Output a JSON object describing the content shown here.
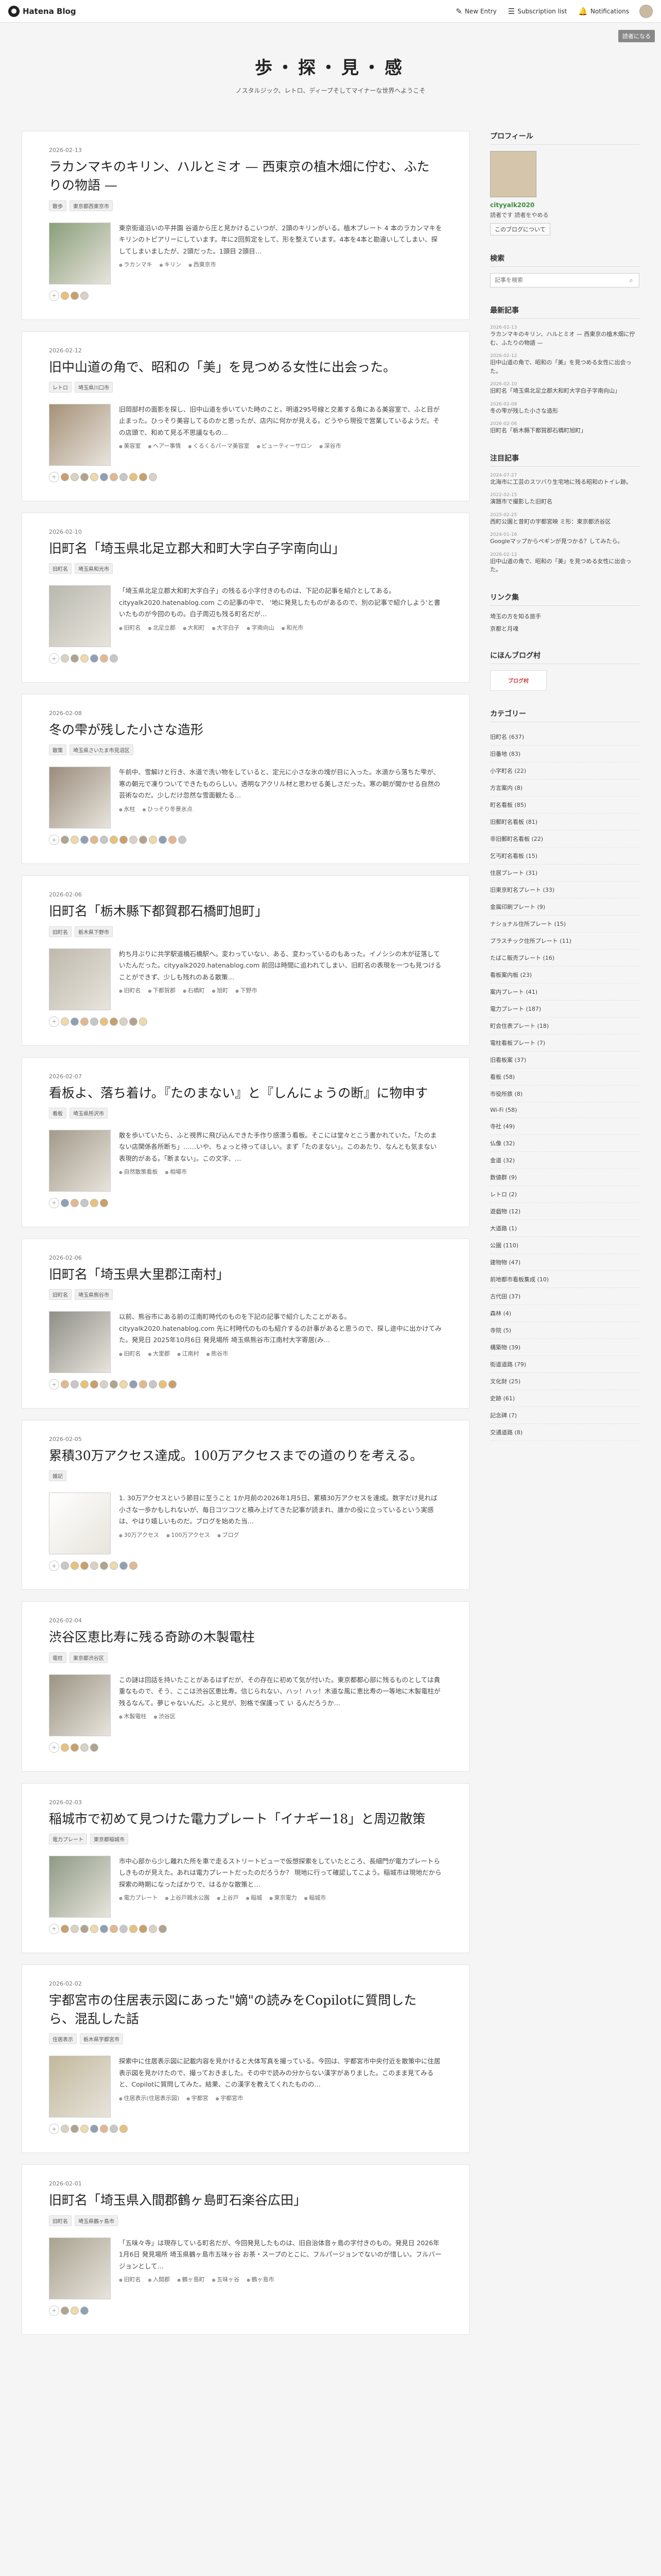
{
  "topbar": {
    "brand": "Hatena Blog",
    "new_entry": "New Entry",
    "subscription": "Subscription list",
    "notifications": "Notifications"
  },
  "readers_label": "読者になる",
  "blog": {
    "title": "歩・探・見・感",
    "description": "ノスタルジック、レトロ、ディープそしてマイナーな世界へようこそ"
  },
  "entries": [
    {
      "date": "2026-02-13",
      "title": "ラカンマキのキリン、ハルとミオ — 西東京の植木畑に佇む、ふたりの物語 —",
      "cats": [
        "散歩",
        "東京都西東京市"
      ],
      "excerpt": "東京街道沿いの平井園 谷道から圧と見かけるこいつが、2頭のキリンがいる。植木プレート 4 本のラカンマキをキリンのトピアリーにしています。年に2回剪定をして、形を整えています。4本を4本と勘違いしてしまい、探してしまいましたが、2頭だった。1頭目 2頭目…",
      "keywords": [
        "ラカンマキ",
        "キリン",
        "西東京市"
      ]
    },
    {
      "date": "2026-02-12",
      "title": "旧中山道の角で、昭和の「美」を見つめる女性に出会った。",
      "cats": [
        "レトロ",
        "埼玉県川口市"
      ],
      "excerpt": "旧岡部村の面影を探し、旧中山道を歩いていた時のこと。明道295号線と交差する角にある美容室で、ふと目が止まった。ひっそり美容してるのかと思ったが、店内に何かが見える。どうやら現役で営業しているようだ。その店頭で、和めて見る不思議なもの…",
      "keywords": [
        "美容室",
        "ヘアー事情",
        "くるくるパーマ美容室",
        "ビューティーサロン",
        "深谷市"
      ]
    },
    {
      "date": "2026-02-10",
      "title": "旧町名「埼玉県北足立郡大和町大字白子字南向山」",
      "cats": [
        "旧町名",
        "埼玉県和光市"
      ],
      "excerpt": "「埼玉県北足立郡大和町大字白子」の残るる小字付きのものは、下記の記事を紹介としてある。cityyalk2020.hatenablog.com この記事の中で、 '地に発見したものがあるので、別の記事で紹介しよう'と書いたものが今回のもの。白子周辺も残る町名だが…",
      "keywords": [
        "旧町名",
        "北足立郡",
        "大和町",
        "大字白子",
        "字南向山",
        "和光市"
      ]
    },
    {
      "date": "2026-02-08",
      "title": "冬の雫が残した小さな造形",
      "cats": [
        "散策",
        "埼玉県さいたま市見沼区"
      ],
      "excerpt": "午前中、雪解けと行き、水道で洗い物をしていると、定元に小さな氷の塊が目に入った。水滴から落ちた雫が、寒の朝元で凍りついてできたものらしい。透明なアクリル材と思わせる美しさだった。寒の朝が聞かせる自然の芸術なのだ。少しだけ忽然な雪面観たる…",
      "keywords": [
        "氷柱",
        "ひっそり冬景氷点"
      ]
    },
    {
      "date": "2026-02-06",
      "title": "旧町名「栃木縣下都賀郡石橋町旭町」",
      "cats": [
        "旧町名",
        "栃木県下野市"
      ],
      "excerpt": "約ち月ぶりに共学駅道橋石橋駅へ。変わっていない、ある、変わっているのもあった。イノシシの木が征落していたんだった。cityyalk2020.hatenablog.com 前回は時間に追われてしまい、旧町名の表現を一つも見つけることができず、少しも残れのある散策…",
      "keywords": [
        "旧町名",
        "下都賀郡",
        "石橋町",
        "旭町",
        "下野市"
      ]
    },
    {
      "date": "2026-02-07",
      "title": "看板よ、落ち着け。『たのまない』と『しんにょうの断』に物申す",
      "cats": [
        "看板",
        "埼玉県所沢市"
      ],
      "excerpt": "散を歩いていたら、ふと視界に飛び込んできた手作り感漂う看板。そこには堂々とこう書かれていた。「たのまない店関係各所断ち」……いや、ちょっと待ってほしい。まず「たのまない」。このあたり、なんとも気まない表現的がある。「断まない」。この文字、…",
      "keywords": [
        "自然散策看板",
        "相場市"
      ]
    },
    {
      "date": "2026-02-06",
      "title": "旧町名「埼玉県大里郡江南村」",
      "cats": [
        "旧町名",
        "埼玉県熊谷市"
      ],
      "excerpt": "以前、熊谷市にある前の江南町時代のものを下記の記事で紹介したことがある。cityyalk2020.hatenablog.com 先に村時代のものも紹介するの計事があると思うので、探し途中に出かけてみた。発見日 2025年10月6日 発見場所 埼玉県熊谷市江南村大字寄居(み…",
      "keywords": [
        "旧町名",
        "大里郡",
        "江南村",
        "熊谷市"
      ]
    },
    {
      "date": "2026-02-05",
      "title": "累積30万アクセス達成。100万アクセスまでの道のりを考える。",
      "cats": [
        "雑記"
      ],
      "excerpt": "1. 30万アクセスという節目に至うこと 1か月前の2026年1月5日、累積30万アクセスを達成。数字だけ見れば小さな一歩かもしれないが、毎日コツコツと積み上げてきた記事が読まれ、誰かの役に立っているという実感は、やはり嬉しいものだ。ブログを始めた当…",
      "keywords": [
        "30万アクセス",
        "100万アクセス",
        "ブログ"
      ]
    },
    {
      "date": "2026-02-04",
      "title": "渋谷区恵比寿に残る奇跡の木製電柱",
      "cats": [
        "電柱",
        "東京都渋谷区"
      ],
      "excerpt": "この謎は回話を持いたことがあるはずだが、その存在に初めて気が付いた。東京都都心部に残るものとしては貴重なもので、そう、ここは渋谷区恵比寿。信じられない、ハッ！ハッ！木道な風に恵比寿の一等地に木製電柱が残るなんて。夢じゃないんだ。ふと見が、別格で保護って い るんだろうか…",
      "keywords": [
        "木製電柱",
        "渋谷区"
      ]
    },
    {
      "date": "2026-02-03",
      "title": "稲城市で初めて見つけた電力プレート「イナギー18」と周辺散策",
      "cats": [
        "電力プレート",
        "東京都稲城市"
      ],
      "excerpt": "市中心部から少し離れた所を車で走るストリートビューで仮想探索をしていたところ、長細門が電力プレートらしきものが見えた。あれは電力プレートだったのだろうか？ 現地に行って確認してこよう。稲城市は現地だから探索の時期になったばかりで、はるかな散策と…",
      "keywords": [
        "電力プレート",
        "上谷戸親水公園",
        "上谷戸",
        "稲城",
        "東京電力",
        "稲城市"
      ]
    },
    {
      "date": "2026-02-02",
      "title": "宇都宮市の住居表示図にあった\"嫡\"の読みをCopilotに質問したら、混乱した話",
      "cats": [
        "住居表示",
        "栃木県宇都宮市"
      ],
      "excerpt": "探索中に住居表示図に記載内容を見かけると大体写真を撮っている。今回は、宇都宮市中央付近を散策中に住居表示図を見かけたので、撮っておきました。その中で読みの分からない漢字がありました。このまま見てみると、Copilotに質問してみた。結果、この漢字を教えてくれたものの…",
      "keywords": [
        "住居表示(住居表示図)",
        "宇都宮",
        "宇都宮市"
      ]
    },
    {
      "date": "2026-02-01",
      "title": "旧町名「埼玉県入間郡鶴ヶ島町石楽谷広田」",
      "cats": [
        "旧町名",
        "埼玉県鶴ヶ島市"
      ],
      "excerpt": "「五味々寺」は現存している町名だが、今回発見したものは、旧自治体音ヶ島の字付きのもの。発見日 2026年1月6日 発見場所 埼玉県鶴ヶ島市五味ヶ谷 お茶・スープのとこに、フルパージョンでないのが惜しい。フルバージョンとして…",
      "keywords": [
        "旧町名",
        "入間郡",
        "鶴ヶ島町",
        "五味ヶ谷",
        "鶴ヶ島市"
      ]
    }
  ],
  "sidebar": {
    "profile_title": "プロフィール",
    "profile_id": "cityyalk2020",
    "readers_count": "読者です 読者をやめる",
    "follow": "このブログについて",
    "search_title": "検索",
    "search_placeholder": "記事を検索",
    "recent_title": "最新記事",
    "recent": [
      {
        "date": "2026-02-13",
        "title": "ラカンマキのキリン、ハルとミオ — 西東京の植木畑に佇む、ふたりの物語 —"
      },
      {
        "date": "2026-02-12",
        "title": "旧中山道の角で、昭和の「美」を見つめる女性に出会った。"
      },
      {
        "date": "2026-02-10",
        "title": "旧町名「埼玉県北足立郡大和町大字白子字南向山」"
      },
      {
        "date": "2026-02-08",
        "title": "冬の雫が残した小さな造形"
      },
      {
        "date": "2026-02-06",
        "title": "旧町名「栃木縣下都賀郡石橋町旭町」"
      }
    ],
    "popular_title": "注目記事",
    "popular": [
      {
        "date": "2024-07-27",
        "title": "北海市に工芸のスツバり生宅地に残る昭和のトイレ跡。"
      },
      {
        "date": "2022-02-15",
        "title": "演題市で撮影した旧町名"
      },
      {
        "date": "2025-02-25",
        "title": "西町公園と昔町の宇都宮映 ミ形：東京都渋谷区"
      },
      {
        "date": "2024-01-16",
        "title": "Googleマップからペギンが見つかる？してみたら。"
      },
      {
        "date": "2026-02-12",
        "title": "旧中山道の角で、昭和の「美」を見つめる女性に出会った。"
      }
    ],
    "links_title": "リンク集",
    "links": [
      "埼玉の方を知る旅手",
      "京都と月魂"
    ],
    "ranking_title": "にほんブログ村",
    "ranking_label": "ブログ村",
    "categories_title": "カテゴリー",
    "categories": [
      "旧町名 (637)",
      "旧番地 (83)",
      "小字町名 (22)",
      "方言案内 (8)",
      "町名看板 (85)",
      "旧郵町名看板 (81)",
      "非旧郵町名看板 (22)",
      "乞丐町名看板 (15)",
      "住居プレート (31)",
      "旧東京町名プレート (33)",
      "金属印刷プレート (9)",
      "ナショナル住所プレート (15)",
      "プラスチック住所プレート (11)",
      "たばこ販売プレート (16)",
      "看板案内板 (23)",
      "案内プレート (41)",
      "電力プレート (187)",
      "町会住表プレート (18)",
      "電柱看板プレート (7)",
      "旧看板案 (37)",
      "看板 (58)",
      "市役所鉄 (8)",
      "Wi-Fi (58)",
      "寺社 (49)",
      "仏像 (32)",
      "金道 (32)",
      "数値群 (9)",
      "レトロ (2)",
      "遊戯物 (12)",
      "大道路 (1)",
      "公園 (110)",
      "建物物 (47)",
      "前地都市看板集成 (10)",
      "古代田 (37)",
      "森林 (4)",
      "寺院 (5)",
      "構築物 (39)",
      "街道道路 (79)",
      "文化財 (25)",
      "史跡 (61)",
      "記念碑 (7)",
      "交通道路 (8)"
    ]
  }
}
